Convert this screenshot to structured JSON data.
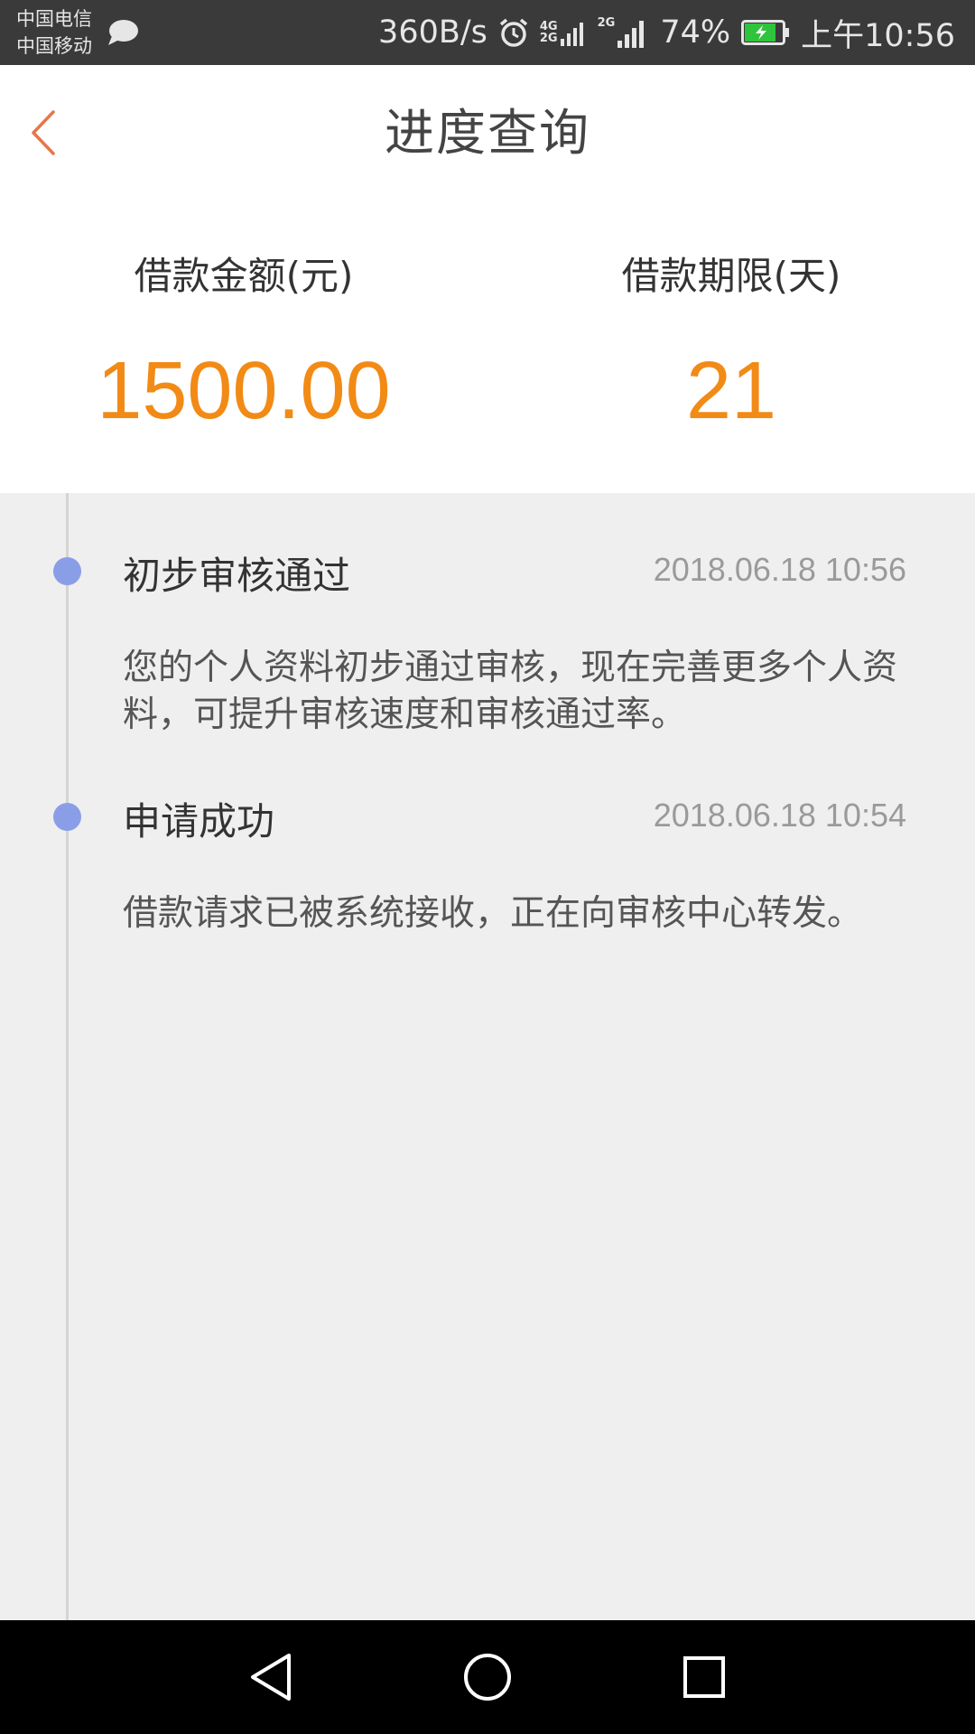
{
  "status_bar": {
    "carrier_1": "中国电信",
    "carrier_2": "中国移动",
    "speed": "360B/s",
    "net_label_1_top": "4G",
    "net_label_1_bottom": "2G",
    "net_label_2": "2G",
    "battery_percent": "74%",
    "time": "上午10:56",
    "battery_color": "#2ec43b"
  },
  "header": {
    "title": "进度查询",
    "accent_color": "#e8754a"
  },
  "summary": {
    "amount_label": "借款金额(元)",
    "amount_value": "1500.00",
    "term_label": "借款期限(天)",
    "term_value": "21",
    "value_color": "#f28a16"
  },
  "timeline": {
    "dot_color": "#8a9ee8",
    "items": [
      {
        "title": "初步审核通过",
        "time": "2018.06.18 10:56",
        "description": "您的个人资料初步通过审核，现在完善更多个人资料，可提升审核速度和审核通过率。"
      },
      {
        "title": "申请成功",
        "time": "2018.06.18 10:54",
        "description": "借款请求已被系统接收，正在向审核中心转发。"
      }
    ]
  },
  "nav_bar": {
    "back_icon": "triangle-back-icon",
    "home_icon": "circle-home-icon",
    "recent_icon": "square-recent-icon"
  }
}
